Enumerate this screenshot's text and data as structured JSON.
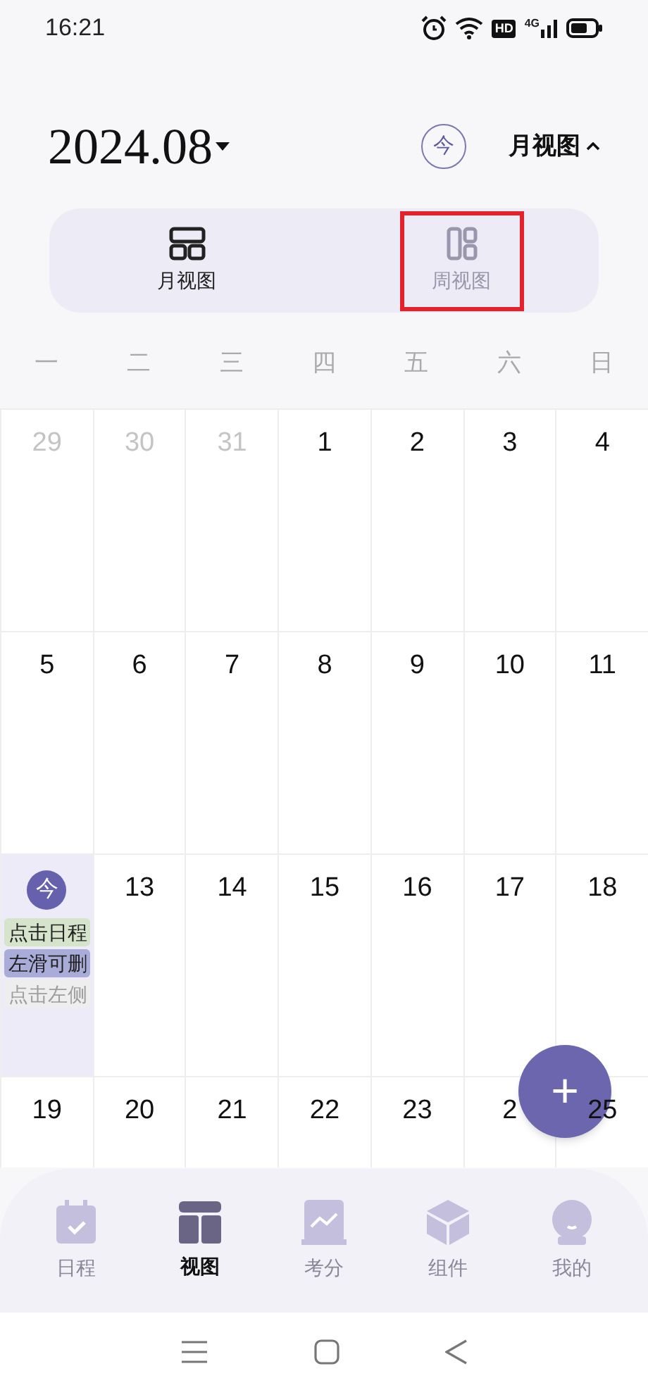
{
  "status_bar": {
    "time": "16:21",
    "hd_badge": "HD",
    "network": "4G"
  },
  "header": {
    "month": "2024.08",
    "today_button": "今",
    "view_switch": "月视图",
    "switch_expanded": true
  },
  "view_tabs": [
    {
      "label": "月视图",
      "selected": true,
      "highlighted": false,
      "kind": "month"
    },
    {
      "label": "周视图",
      "selected": false,
      "highlighted": true,
      "kind": "week"
    }
  ],
  "weekdays": [
    "一",
    "二",
    "三",
    "四",
    "五",
    "六",
    "日"
  ],
  "weeks": [
    [
      {
        "day": "29",
        "muted": true
      },
      {
        "day": "30",
        "muted": true
      },
      {
        "day": "31",
        "muted": true
      },
      {
        "day": "1",
        "muted": false
      },
      {
        "day": "2",
        "muted": false
      },
      {
        "day": "3",
        "muted": false
      },
      {
        "day": "4",
        "muted": false
      }
    ],
    [
      {
        "day": "5",
        "muted": false
      },
      {
        "day": "6",
        "muted": false
      },
      {
        "day": "7",
        "muted": false
      },
      {
        "day": "8",
        "muted": false
      },
      {
        "day": "9",
        "muted": false
      },
      {
        "day": "10",
        "muted": false
      },
      {
        "day": "11",
        "muted": false
      }
    ],
    [
      {
        "day": "今",
        "today": true,
        "events": [
          {
            "title": "点击日程",
            "color": "#d6e4cc",
            "faded": false
          },
          {
            "title": "左滑可删",
            "color": "#a9acd8",
            "faded": false
          },
          {
            "title": "点击左侧",
            "color": "#eeeeee",
            "faded": true
          }
        ]
      },
      {
        "day": "13",
        "muted": false
      },
      {
        "day": "14",
        "muted": false
      },
      {
        "day": "15",
        "muted": false
      },
      {
        "day": "16",
        "muted": false
      },
      {
        "day": "17",
        "muted": false
      },
      {
        "day": "18",
        "muted": false
      }
    ],
    [
      {
        "day": "19",
        "muted": false
      },
      {
        "day": "20",
        "muted": false
      },
      {
        "day": "21",
        "muted": false
      },
      {
        "day": "22",
        "muted": false
      },
      {
        "day": "23",
        "muted": false
      },
      {
        "day": "2",
        "muted": false
      },
      {
        "day": "25",
        "muted": false
      }
    ]
  ],
  "fab": "+",
  "bottom_nav": [
    {
      "label": "日程",
      "selected": false,
      "kind": "calendar"
    },
    {
      "label": "视图",
      "selected": true,
      "kind": "layout"
    },
    {
      "label": "考分",
      "selected": false,
      "kind": "chart"
    },
    {
      "label": "组件",
      "selected": false,
      "kind": "cube"
    },
    {
      "label": "我的",
      "selected": false,
      "kind": "profile"
    }
  ]
}
